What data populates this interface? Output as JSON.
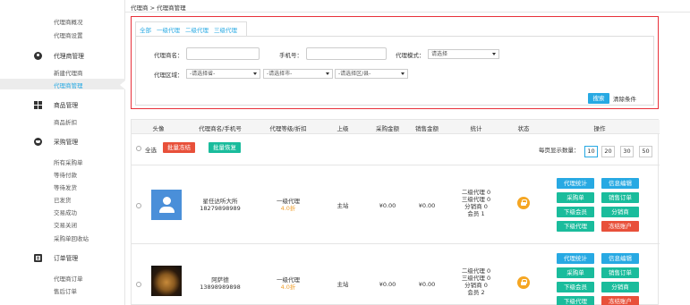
{
  "sidebar": {
    "agent_overview": "代理商概况",
    "agent_settings": "代理商设置",
    "agent_manage_section": "代理商管理",
    "new_agent": "新建代理商",
    "agent_manage": "代理商管理",
    "product_manage_section": "商品管理",
    "product_discount": "商品折扣",
    "purchase_manage_section": "采购管理",
    "all_purchase_orders": "所有采购单",
    "pending_payment": "等待付款",
    "pending_shipment": "等待发货",
    "shipped": "已发货",
    "trade_success": "交易成功",
    "trade_closed": "交易关闭",
    "purchase_recycle": "采购单回收站",
    "order_manage_section": "订单管理",
    "agent_orders": "代理商订单",
    "after_sale_orders": "售后订单"
  },
  "breadcrumb": "代理商 > 代理商管理",
  "filter": {
    "tabs": [
      "全部",
      "一级代理",
      "二级代理",
      "三级代理"
    ],
    "agent_name_label": "代理商名：",
    "phone_label": "手机号：",
    "mode_label": "代理模式：",
    "mode_value": "请选择",
    "region_label": "代理区域：",
    "province_value": "-请选择省-",
    "city_value": "-请选择市-",
    "district_value": "-请选择区/县-",
    "search_btn": "搜索",
    "clear_btn": "清除条件"
  },
  "table": {
    "headers": [
      "头像",
      "代理商名/手机号",
      "代理等级/折扣",
      "上级",
      "采购金额",
      "销售金额",
      "统计",
      "状态",
      "操作"
    ],
    "select_all": "全选",
    "batch_freeze": "批量冻结",
    "batch_restore": "批量恢复",
    "page_size_label": "每页显示数量：",
    "page_sizes": [
      "10",
      "20",
      "30",
      "50"
    ],
    "rows": [
      {
        "name": "星任达听大所",
        "phone": "18279898989",
        "level": "一级代理",
        "discount": "4.0折",
        "parent": "主站",
        "purchase": "¥0.00",
        "sales": "¥0.00",
        "stats": [
          "二级代理 0",
          "三级代理 0",
          "分销商 0",
          "会员 1"
        ],
        "ops": [
          "代理统计",
          "信息编辑",
          "采购单",
          "销售订单",
          "下级会员",
          "分销商",
          "下级代理",
          "冻结账户"
        ]
      },
      {
        "name": "阿萨德",
        "phone": "13898989898",
        "level": "一级代理",
        "discount": "4.0折",
        "parent": "主站",
        "purchase": "¥0.00",
        "sales": "¥0.00",
        "stats": [
          "二级代理 0",
          "三级代理 0",
          "分销商 0",
          "会员 2"
        ],
        "ops": [
          "代理统计",
          "信息编辑",
          "采购单",
          "销售订单",
          "下级会员",
          "分销商",
          "下级代理",
          "冻结账户"
        ]
      }
    ]
  },
  "colors": {
    "accent": "#27a9e3",
    "highlight_border": "#e8313a",
    "green": "#1abc9c",
    "red": "#e8503a",
    "orange": "#f0a030"
  }
}
